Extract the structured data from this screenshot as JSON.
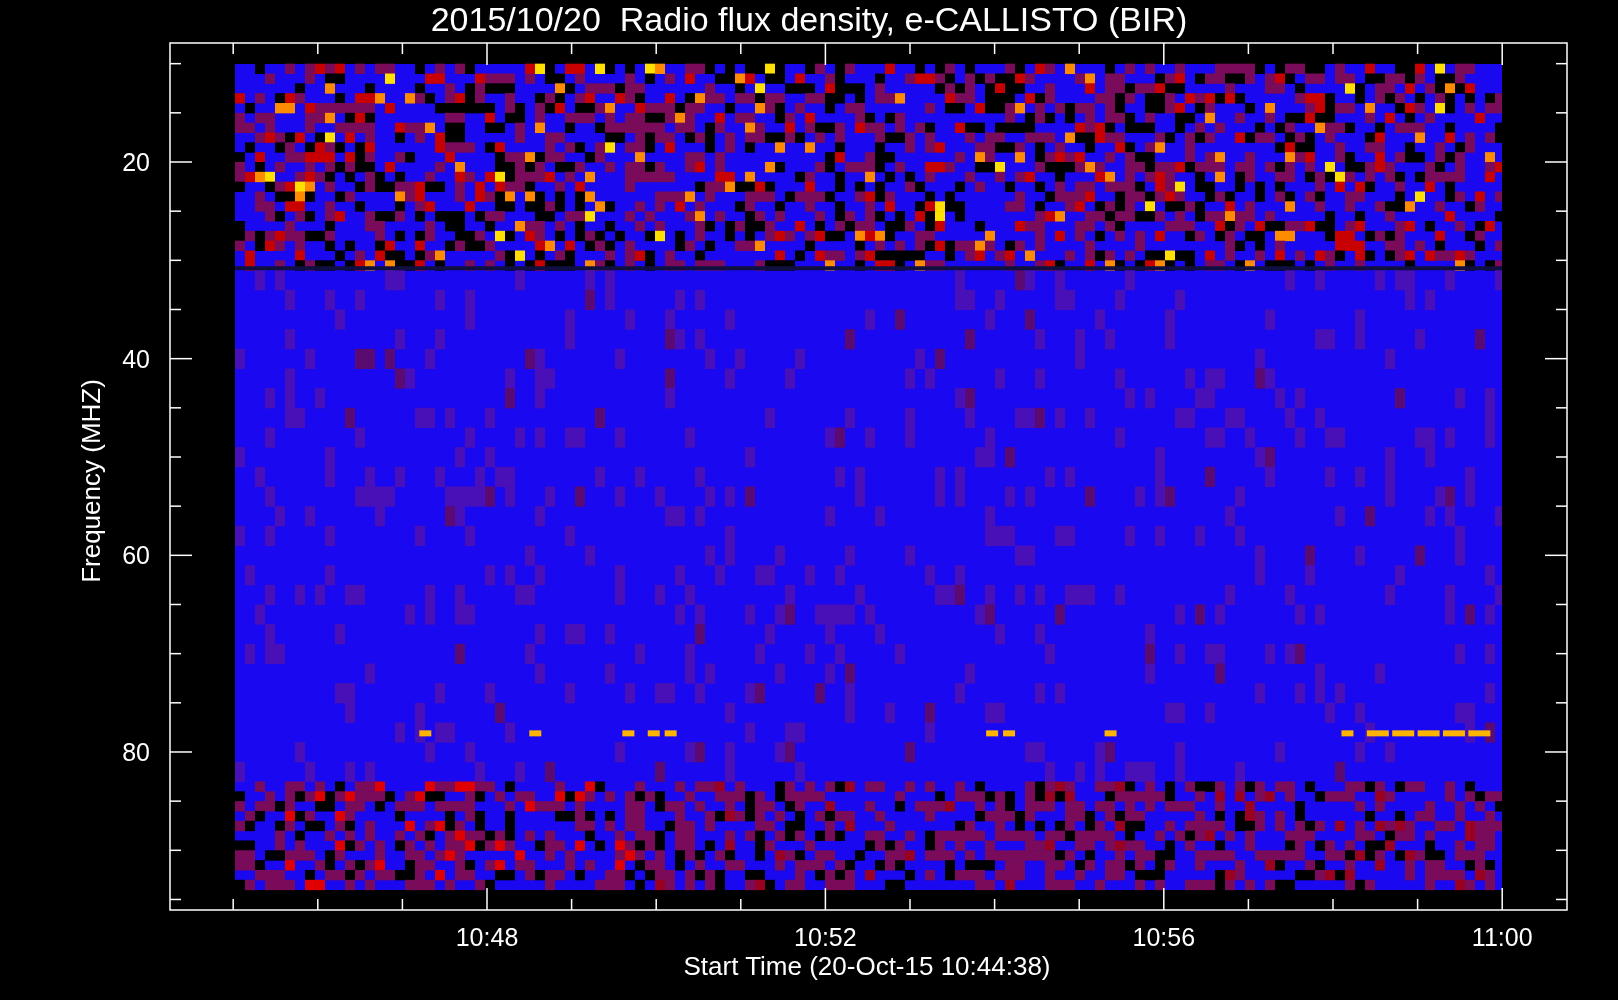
{
  "title": "2015/10/20  Radio flux density, e-CALLISTO (BIR)",
  "y_axis": {
    "label": "Frequency (MHZ)",
    "ticks": [
      "20",
      "40",
      "60",
      "80"
    ]
  },
  "x_axis": {
    "label": "Start Time (20-Oct-15 10:44:38)",
    "ticks": [
      "10:48",
      "10:52",
      "10:56",
      "11:00"
    ]
  }
}
